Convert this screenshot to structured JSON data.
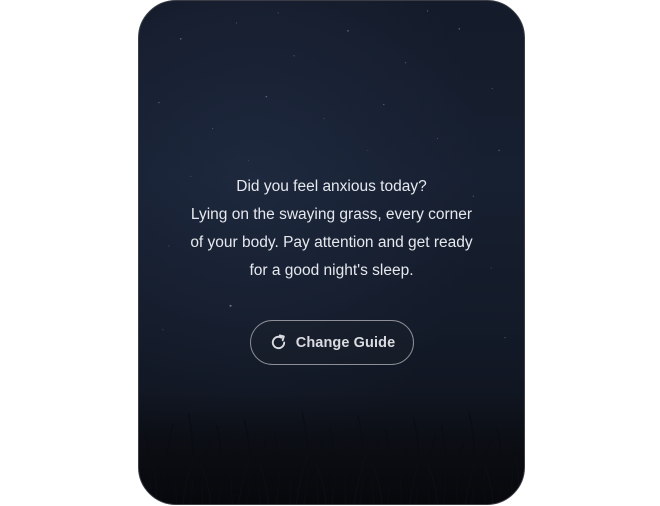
{
  "guide": {
    "lines": [
      "Did you feel anxious today?",
      "Lying on the swaying grass, every corner",
      "of your body. Pay attention and get ready",
      "for a good night's sleep."
    ]
  },
  "actions": {
    "change_guide_label": "Change Guide",
    "change_guide_icon": "refresh-icon"
  },
  "colors": {
    "background": "#ffffff",
    "card_top": "#141b2a",
    "card_bottom": "#0c0f16",
    "text": "#e6e8ee",
    "button_border": "#8c8f97"
  }
}
